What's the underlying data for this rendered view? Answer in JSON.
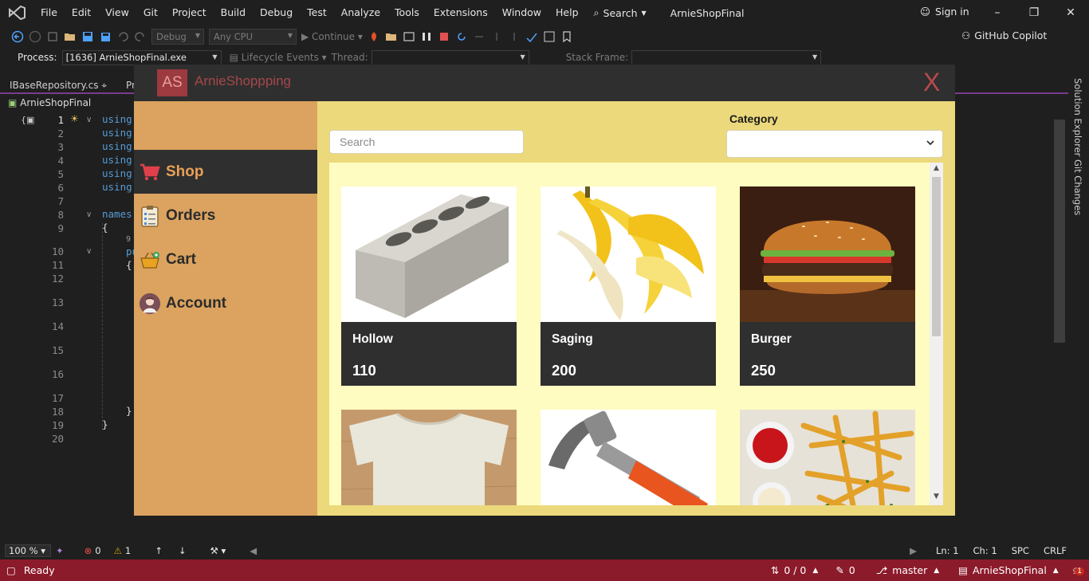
{
  "menubar": {
    "items": [
      "File",
      "Edit",
      "View",
      "Git",
      "Project",
      "Build",
      "Debug",
      "Test",
      "Analyze",
      "Tools",
      "Extensions",
      "Window",
      "Help"
    ],
    "search_label": "Search",
    "solution_name": "ArnieShopFinal",
    "signin_label": "Sign in"
  },
  "toolbar": {
    "config": "Debug",
    "platform": "Any CPU",
    "continue_label": "Continue",
    "copilot_label": "GitHub Copilot"
  },
  "debug_toolbar": {
    "process_label": "Process:",
    "process_value": "[1636] ArnieShopFinal.exe",
    "lifecycle_label": "Lifecycle Events",
    "thread_label": "Thread:",
    "stackframe_label": "Stack Frame:"
  },
  "tabs": {
    "tab1": "IBaseRepository.cs",
    "tab2": "Pr",
    "nav_project": "ArnieShopFinal"
  },
  "editor": {
    "line_numbers": [
      "1",
      "2",
      "3",
      "4",
      "5",
      "6",
      "7",
      "8",
      "9",
      "10",
      "11",
      "12",
      "13",
      "14",
      "15",
      "16",
      "17",
      "18",
      "19",
      "20"
    ],
    "code_using": "using",
    "code_namespace": "names",
    "brace_open": "{",
    "brace_close": "}",
    "ref_count": "9",
    "pu": "pu"
  },
  "side_rail": {
    "solution_explorer": "Solution Explorer",
    "git_changes": "Git Changes"
  },
  "editor_status": {
    "zoom": "100 %",
    "errors": "0",
    "warnings": "1",
    "ln": "Ln: 1",
    "ch": "Ch: 1",
    "spc": "SPC",
    "crlf": "CRLF"
  },
  "statusbar": {
    "ready": "Ready",
    "updown": "0 / 0",
    "pencil_count": "0",
    "branch": "master",
    "repo": "ArnieShopFinal",
    "notif_count": "1"
  },
  "app": {
    "logo": "AS",
    "name": "ArnieShoppping",
    "close": "X",
    "nav": [
      {
        "label": "Shop",
        "icon": "cart-icon"
      },
      {
        "label": "Orders",
        "icon": "clipboard-icon"
      },
      {
        "label": "Cart",
        "icon": "basket-icon"
      },
      {
        "label": "Account",
        "icon": "user-avatar-icon"
      }
    ],
    "search_placeholder": "Search",
    "category_label": "Category",
    "category_value": "",
    "products": [
      {
        "name": "Hollow",
        "price": "110",
        "image": "hollow-block-image"
      },
      {
        "name": "Saging",
        "price": "200",
        "image": "banana-image"
      },
      {
        "name": "Burger",
        "price": "250",
        "image": "burger-image"
      },
      {
        "name": "",
        "price": "",
        "image": "tshirt-image"
      },
      {
        "name": "",
        "price": "",
        "image": "hammer-image"
      },
      {
        "name": "",
        "price": "",
        "image": "fries-image"
      }
    ]
  }
}
